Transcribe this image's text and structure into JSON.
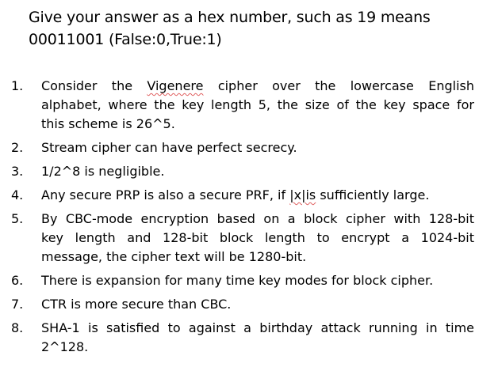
{
  "title": {
    "line1": "Give your answer as a hex number, such as 19 means",
    "line2": "00011001 (False:0,True:1)"
  },
  "questions": [
    {
      "number": "1.",
      "lines": {
        "l1a": "Consider the ",
        "l1b": "Vigenere",
        "l1c": " cipher over the lowercase English",
        "l2": "alphabet, where the key length 5, the size of the key space for",
        "l3": "this scheme is 26^5."
      }
    },
    {
      "number": "2.",
      "text": "Stream cipher can have perfect secrecy."
    },
    {
      "number": "3.",
      "text": "1/2^8 is negligible."
    },
    {
      "number": "4.",
      "parts": {
        "a": "Any secure PRP is also a secure PRF, if ",
        "b": "|x|is",
        "c": " sufficiently large."
      }
    },
    {
      "number": "5.",
      "lines": {
        "l1": "By CBC-mode encryption based on a block cipher with 128-bit",
        "l2": "key length and 128-bit block length to encrypt a 1024-bit",
        "l3": "message, the cipher text will be 1280-bit."
      }
    },
    {
      "number": "6.",
      "text": "There is expansion for many time key modes for block cipher."
    },
    {
      "number": "7.",
      "text": "CTR is more secure than CBC."
    },
    {
      "number": "8.",
      "lines": {
        "l1": "SHA-1 is satisfied to against a birthday attack running in time",
        "l2": "2^128."
      }
    }
  ]
}
